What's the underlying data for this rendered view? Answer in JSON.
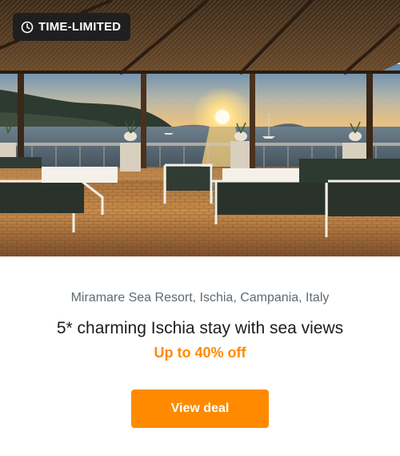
{
  "badge": {
    "label": "TIME-LIMITED",
    "icon": "clock-icon"
  },
  "deal": {
    "location": "Miramare Sea Resort, Ischia, Campania, Italy",
    "title": "5* charming Ischia stay with sea views",
    "discount": "Up to 40% off",
    "cta_label": "View deal"
  },
  "colors": {
    "accent": "#ff8a00",
    "badge_bg": "#1f1f1f",
    "location_text": "#5e6b73",
    "title_text": "#1c1c1c"
  }
}
